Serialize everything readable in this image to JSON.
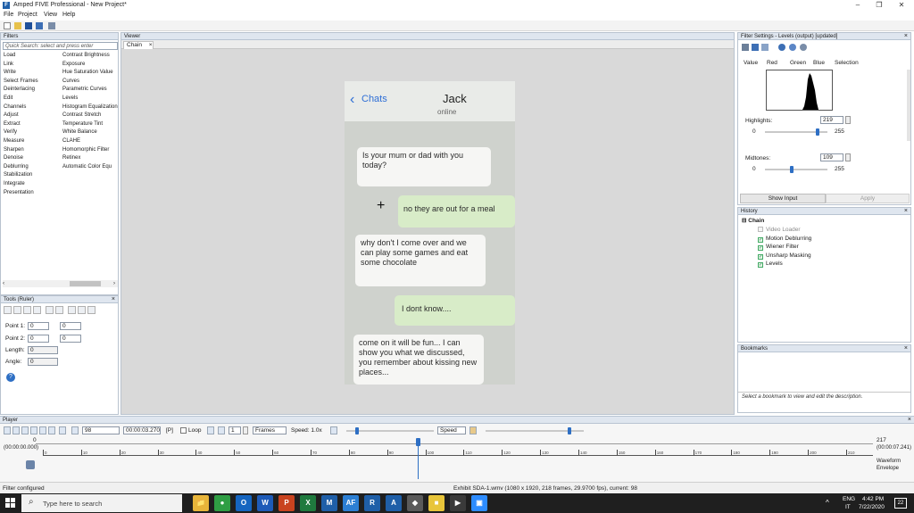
{
  "window": {
    "title": "Amped FIVE Professional - New Project*",
    "app_icon": "F",
    "controls": [
      "–",
      "❐",
      "✕"
    ]
  },
  "menu": [
    "File",
    "Project",
    "View",
    "Help"
  ],
  "filters_panel": {
    "title": "Filters",
    "search_placeholder": "Quick Search: select and press enter",
    "categories": [
      "Load",
      "Link",
      "Write",
      "Select Frames",
      "Deinterlacing",
      "Edit",
      "Channels",
      "Adjust",
      "Extract",
      "Verify",
      "Measure",
      "Sharpen",
      "Denoise",
      "Deblurring",
      "Stabilization",
      "Integrate",
      "Presentation"
    ],
    "items": [
      "Contrast Brightness",
      "Exposure",
      "Hue Saturation Value",
      "Curves",
      "Parametric Curves",
      "Levels",
      "Histogram Equalization",
      "Contrast Stretch",
      "Temperature Tint",
      "White Balance",
      "CLAHE",
      "Homomorphic Filter",
      "Retinex",
      "Automatic Color Equ"
    ]
  },
  "tools_panel": {
    "title": "Tools (Ruler)",
    "point1_label": "Point 1:",
    "point2_label": "Point 2:",
    "length_label": "Length:",
    "angle_label": "Angle:",
    "point1": [
      "0",
      "0"
    ],
    "point2": [
      "0",
      "0"
    ],
    "length": "0",
    "angle": "0"
  },
  "viewer": {
    "title": "Viewer",
    "tab": "Chain",
    "tab_close": "×",
    "chat": {
      "back": "Chats",
      "contact": "Jack",
      "status": "online",
      "messages": [
        {
          "from": "in",
          "text": "Is your mum or dad with you today?"
        },
        {
          "from": "out",
          "text": "no they are out for a meal"
        },
        {
          "from": "in",
          "text": "why don't I come over and we can play some games and eat some chocolate"
        },
        {
          "from": "out",
          "text": "I dont know...."
        },
        {
          "from": "in",
          "text": "come on it will be fun... I can show you what we discussed, you remember about kissing new places..."
        }
      ]
    }
  },
  "filter_settings": {
    "title": "Filter Settings - Levels (output) [updated]",
    "tabs": [
      "Value",
      "Red",
      "Green",
      "Blue",
      "Selection"
    ],
    "highlights_label": "Highlights:",
    "highlights_value": "219",
    "highlights_range": [
      "0",
      "255"
    ],
    "highlights_level": 219,
    "midtones_label": "Midtones:",
    "midtones_value": "109",
    "midtones_range": [
      "0",
      "255"
    ],
    "midtones_level": 109,
    "show_input": "Show Input",
    "apply": "Apply"
  },
  "history": {
    "title": "History",
    "root": "Chain",
    "items": [
      {
        "label": "Video Loader",
        "checked": false
      },
      {
        "label": "Motion Deblurring",
        "checked": true
      },
      {
        "label": "Wiener Filter",
        "checked": true
      },
      {
        "label": "Unsharp Masking",
        "checked": true
      },
      {
        "label": "Levels",
        "checked": true
      }
    ]
  },
  "bookmarks": {
    "title": "Bookmarks",
    "hint": "Select a bookmark to view and edit the description."
  },
  "player": {
    "title": "Player",
    "frame": "98",
    "time": "00:00:03.270",
    "p_label": "[P]",
    "loop_label": "Loop",
    "step": "1",
    "unit": "Frames",
    "speed_label": "Speed: 1.0x",
    "speed_select": "Speed",
    "start_frame": "0",
    "start_time": "(00:00:00.000)",
    "end_frame": "217",
    "end_time": "(00:00:07.241)",
    "current_frame": 98,
    "total_frames": 217,
    "ticks": [
      "0",
      "10",
      "20",
      "30",
      "40",
      "50",
      "60",
      "70",
      "80",
      "90",
      "100",
      "110",
      "120",
      "130",
      "140",
      "150",
      "160",
      "170",
      "180",
      "190",
      "200",
      "210"
    ],
    "waveform_label": "Waveform Envelope"
  },
  "status": {
    "left": "Filter configured",
    "center": "Exhibit SDA-1.wmv (1080 x 1920, 218 frames, 29.9700 fps), current: 98"
  },
  "taskbar": {
    "search_placeholder": "Type here to search",
    "lang": "ENG",
    "locale": "IT",
    "time": "4:42 PM",
    "date": "7/22/2020",
    "notifications": "22",
    "apps": [
      {
        "name": "file-explorer-icon",
        "glyph": "📁",
        "color": "#e8b53a"
      },
      {
        "name": "chrome-icon",
        "glyph": "●",
        "color": "#2f9e44"
      },
      {
        "name": "outlook-icon",
        "glyph": "O",
        "color": "#1565c0"
      },
      {
        "name": "word-icon",
        "glyph": "W",
        "color": "#1e5bb8"
      },
      {
        "name": "powerpoint-icon",
        "glyph": "P",
        "color": "#c9431f"
      },
      {
        "name": "excel-icon",
        "glyph": "X",
        "color": "#1f7a3e"
      },
      {
        "name": "amped-icon-1",
        "glyph": "M",
        "color": "#1f5fa8"
      },
      {
        "name": "amped-five-icon",
        "glyph": "AF",
        "color": "#2c7fd4"
      },
      {
        "name": "amped-icon-3",
        "glyph": "R",
        "color": "#1f5fa8"
      },
      {
        "name": "amped-icon-4",
        "glyph": "A",
        "color": "#1f5fa8"
      },
      {
        "name": "app-icon-5",
        "glyph": "◆",
        "color": "#5a5a5a"
      },
      {
        "name": "sticky-notes-icon",
        "glyph": "■",
        "color": "#e8c53a"
      },
      {
        "name": "terminal-icon",
        "glyph": "▶",
        "color": "#3a3a3a"
      },
      {
        "name": "zoom-icon",
        "glyph": "▣",
        "color": "#2d8cff"
      }
    ]
  }
}
